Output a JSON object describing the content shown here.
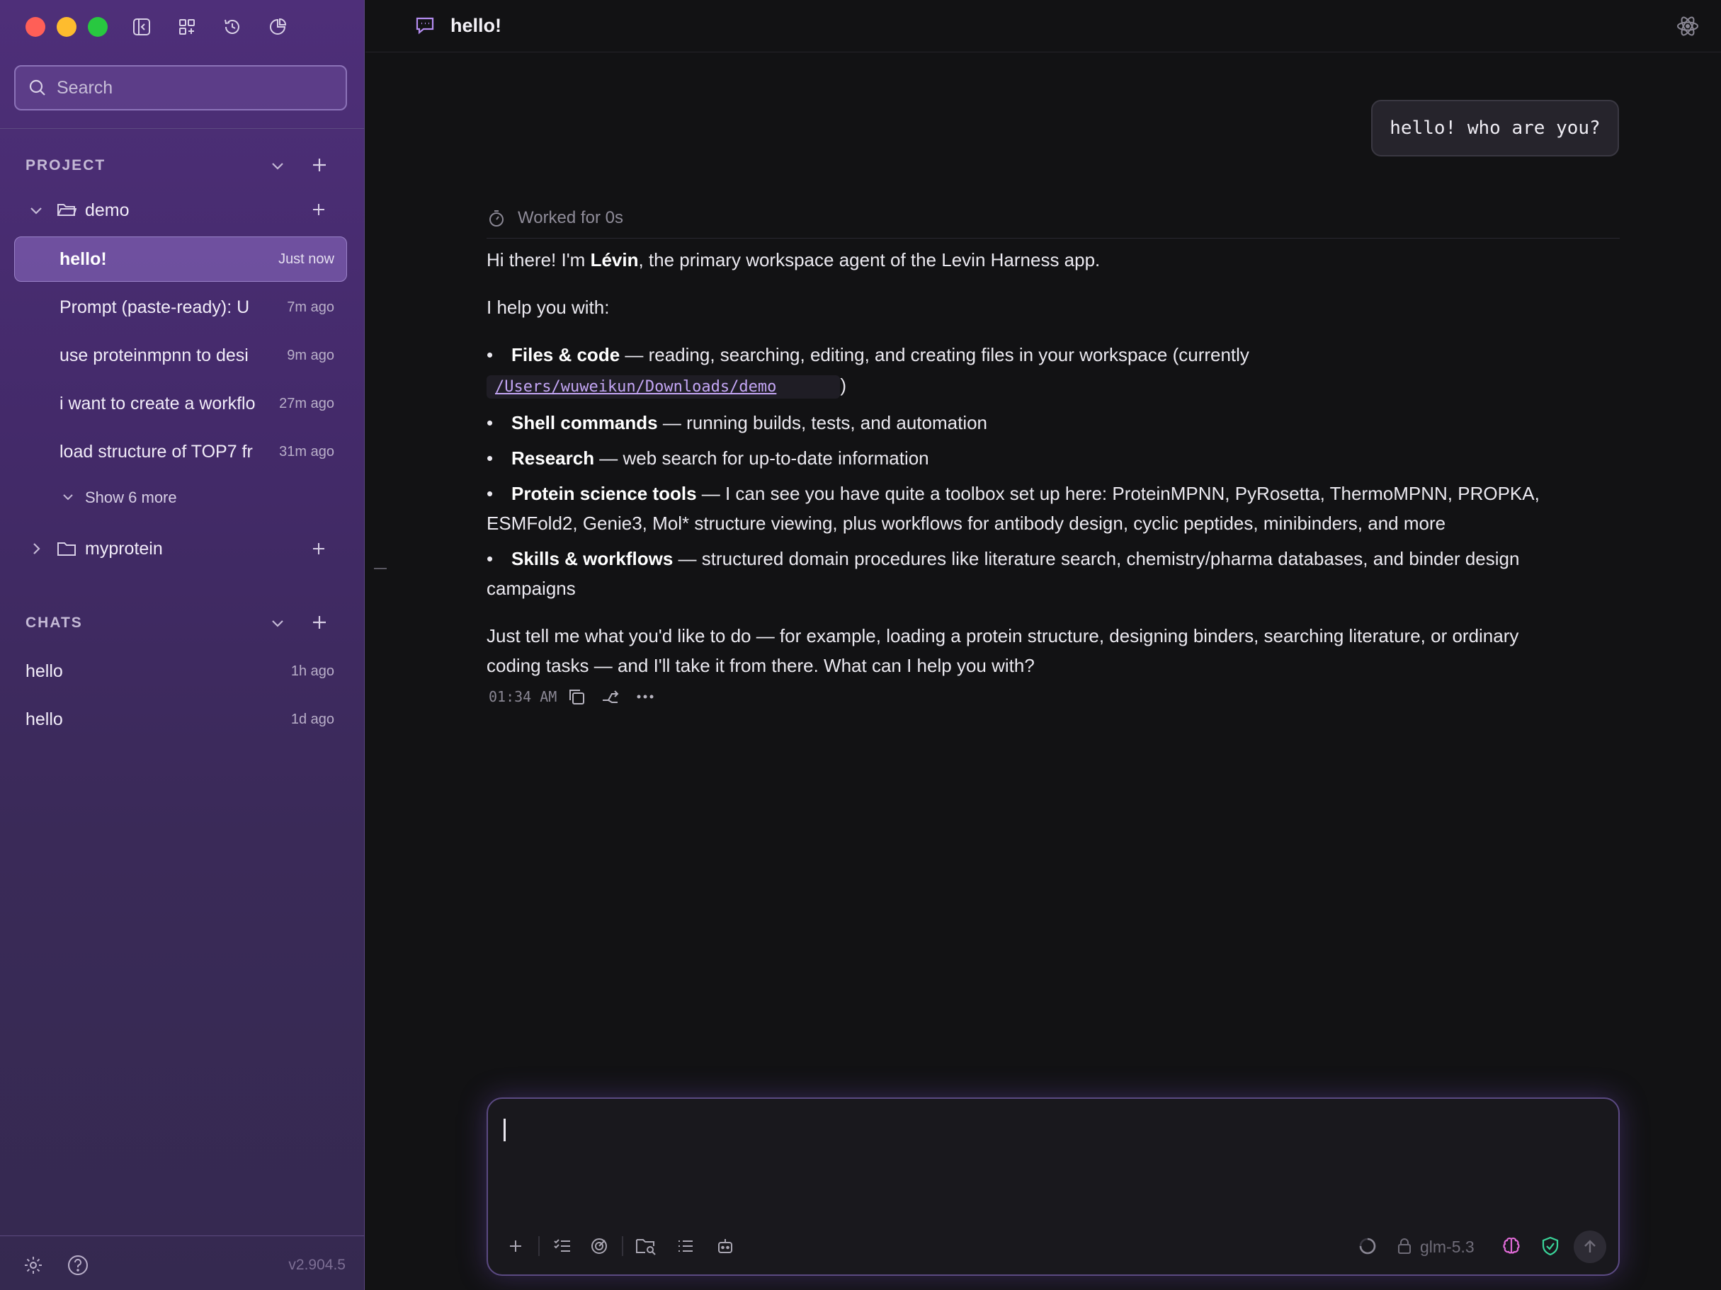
{
  "window": {
    "traffic_colors": [
      "#ff5f57",
      "#febc2e",
      "#28c840"
    ]
  },
  "sidebar": {
    "search_placeholder": "Search",
    "project_section": {
      "title": "PROJECT",
      "folders": [
        {
          "name": "demo",
          "expanded": true,
          "items": [
            {
              "label": "hello!",
              "time": "Just now",
              "active": true
            },
            {
              "label": "Prompt (paste-ready): U",
              "time": "7m ago"
            },
            {
              "label": "use proteinmpnn to desi",
              "time": "9m ago"
            },
            {
              "label": "i want to create a workflo",
              "time": "27m ago"
            },
            {
              "label": "load structure of TOP7 fr",
              "time": "31m ago"
            }
          ],
          "show_more": "Show 6 more"
        },
        {
          "name": "myprotein",
          "expanded": false
        }
      ]
    },
    "chats_section": {
      "title": "CHATS",
      "items": [
        {
          "label": "hello",
          "time": "1h ago"
        },
        {
          "label": "hello",
          "time": "1d ago"
        }
      ]
    },
    "version": "v2.904.5"
  },
  "header": {
    "title": "hello!"
  },
  "conversation": {
    "user_message": "hello! who are you?",
    "worked_for": "Worked for 0s",
    "assistant": {
      "intro_before": "Hi there! I'm ",
      "intro_name": "Lévin",
      "intro_after": ", the primary workspace agent of the Levin Harness app.",
      "help_heading": "I help you with:",
      "bullets": [
        {
          "title": "Files & code",
          "text": " — reading, searching, editing, and creating files in your workspace (currently",
          "code": "/Users/wuweikun/Downloads/demo",
          "after_code": ")"
        },
        {
          "title": "Shell commands",
          "text": " — running builds, tests, and automation"
        },
        {
          "title": "Research",
          "text": " — web search for up-to-date information"
        },
        {
          "title": "Protein science tools",
          "text": " — I can see you have quite a toolbox set up here: ProteinMPNN, PyRosetta, ThermoMPNN, PROPKA,",
          "text2": "ESMFold2, Genie3, Mol* structure viewing, plus workflows for antibody design, cyclic peptides, minibinders, and more"
        },
        {
          "title": "Skills & workflows",
          "text": " — structured domain procedures like literature search, chemistry/pharma databases, and binder design",
          "text2": "campaigns"
        }
      ],
      "closing_line1": "Just tell me what you'd like to do — for example, loading a protein structure, designing binders, searching literature, or ordinary",
      "closing_line2": "coding tasks — and I'll take it from there. What can I help you with?",
      "timestamp": "01:34 AM"
    }
  },
  "composer": {
    "value": "",
    "model": "glm-5.3"
  },
  "colors": {
    "accent": "#8c73b8",
    "code": "#c4a6f5",
    "brain": "#e26bd8",
    "shield": "#3ad59a"
  }
}
